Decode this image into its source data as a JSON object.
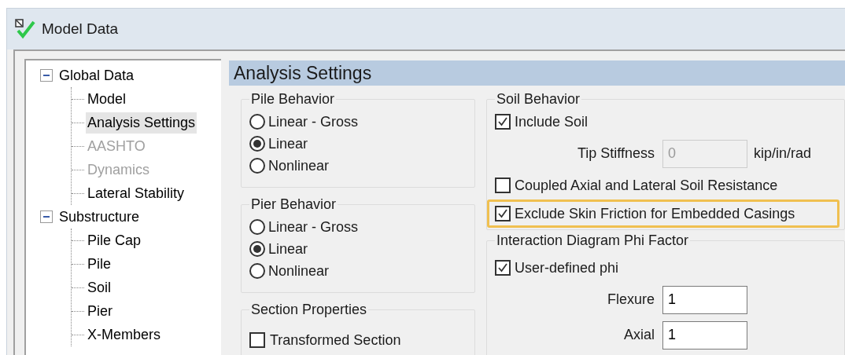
{
  "window": {
    "title": "Model Data"
  },
  "tree": [
    {
      "label": "Global Data",
      "expanded": true,
      "selected": false,
      "disabled": false,
      "children": [
        {
          "label": "Model",
          "selected": false,
          "disabled": false
        },
        {
          "label": "Analysis Settings",
          "selected": true,
          "disabled": false
        },
        {
          "label": "AASHTO",
          "selected": false,
          "disabled": true
        },
        {
          "label": "Dynamics",
          "selected": false,
          "disabled": true
        },
        {
          "label": "Lateral Stability",
          "selected": false,
          "disabled": false
        }
      ]
    },
    {
      "label": "Substructure",
      "expanded": true,
      "selected": false,
      "disabled": false,
      "children": [
        {
          "label": "Pile Cap",
          "selected": false,
          "disabled": false
        },
        {
          "label": "Pile",
          "selected": false,
          "disabled": false
        },
        {
          "label": "Soil",
          "selected": false,
          "disabled": false
        },
        {
          "label": "Pier",
          "selected": false,
          "disabled": false
        },
        {
          "label": "X-Members",
          "selected": false,
          "disabled": false
        }
      ]
    }
  ],
  "page_title": "Analysis Settings",
  "pile_behavior": {
    "title": "Pile Behavior",
    "options": [
      {
        "label": "Linear - Gross",
        "selected": false
      },
      {
        "label": "Linear",
        "selected": true
      },
      {
        "label": "Nonlinear",
        "selected": false
      }
    ]
  },
  "pier_behavior": {
    "title": "Pier Behavior",
    "options": [
      {
        "label": "Linear - Gross",
        "selected": false
      },
      {
        "label": "Linear",
        "selected": true
      },
      {
        "label": "Nonlinear",
        "selected": false
      }
    ]
  },
  "section_properties": {
    "title": "Section Properties",
    "options": [
      {
        "label": "Transformed Section",
        "checked": false
      }
    ]
  },
  "soil_behavior": {
    "title": "Soil Behavior",
    "items": [
      {
        "kind": "checkbox",
        "label": "Include Soil",
        "checked": true,
        "highlighted": false
      },
      {
        "kind": "field",
        "label": "Tip Stiffness",
        "value": "0",
        "unit": "kip/in/rad",
        "disabled": true
      },
      {
        "kind": "checkbox",
        "label": "Coupled Axial and Lateral Soil Resistance",
        "checked": false,
        "highlighted": false
      },
      {
        "kind": "checkbox",
        "label": "Exclude Skin Friction for Embedded Casings",
        "checked": true,
        "highlighted": true
      }
    ]
  },
  "phi_factor": {
    "title": "Interaction Diagram Phi Factor",
    "items": [
      {
        "kind": "checkbox",
        "label": "User-defined phi",
        "checked": true,
        "highlighted": false
      },
      {
        "kind": "field",
        "label": "Flexure",
        "value": "1",
        "disabled": false
      },
      {
        "kind": "field",
        "label": "Axial",
        "value": "1",
        "disabled": false
      }
    ]
  }
}
